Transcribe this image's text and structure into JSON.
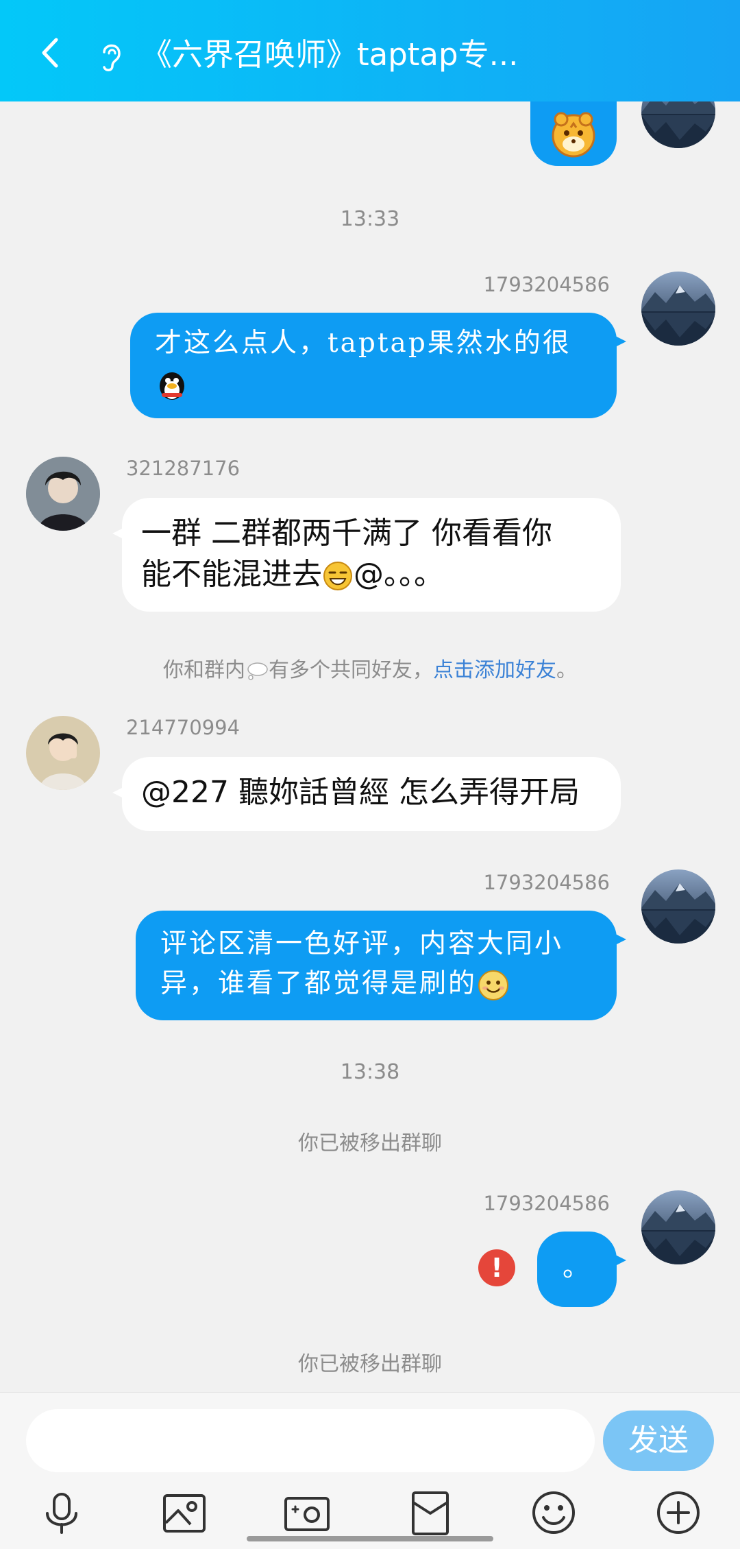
{
  "header": {
    "title": "《六界召唤师》taptap专..."
  },
  "messages": {
    "time1": "13:33",
    "m1_sender": "1793204586",
    "m1_text": "才这么点人，taptap果然水的很",
    "m2_sender": "321287176",
    "m2_line1": "一群  二群都两千满了 你看看你",
    "m2_line2": "能不能混进去",
    "m2_tail": "@。。。",
    "notice_prefix": "你和群内",
    "notice_mid": "有多个共同好友，",
    "notice_link": "点击添加好友",
    "notice_end": "。",
    "m3_sender": "214770994",
    "m3_text": "@227  聽妳話曾經 怎么弄得开局",
    "m4_sender": "1793204586",
    "m4_line1": "评论区清一色好评，内容大同小",
    "m4_line2": "异，谁看了都觉得是刷的",
    "time2": "13:38",
    "system1": "你已被移出群聊",
    "m5_sender": "1793204586",
    "m5_text": "。",
    "fail_mark": "!",
    "system2": "你已被移出群聊"
  },
  "input": {
    "value": "",
    "send_label": "发送"
  },
  "colors": {
    "header_start": "#03c8f9",
    "header_end": "#16a4f4",
    "bubble_self": "#0e9cf3",
    "send_button": "#7bc5f5",
    "fail": "#e5463a"
  },
  "icons": [
    "chevron-left-icon",
    "ear-icon",
    "microphone-icon",
    "image-icon",
    "camera-icon",
    "red-envelope-icon",
    "smiley-icon",
    "plus-icon"
  ]
}
